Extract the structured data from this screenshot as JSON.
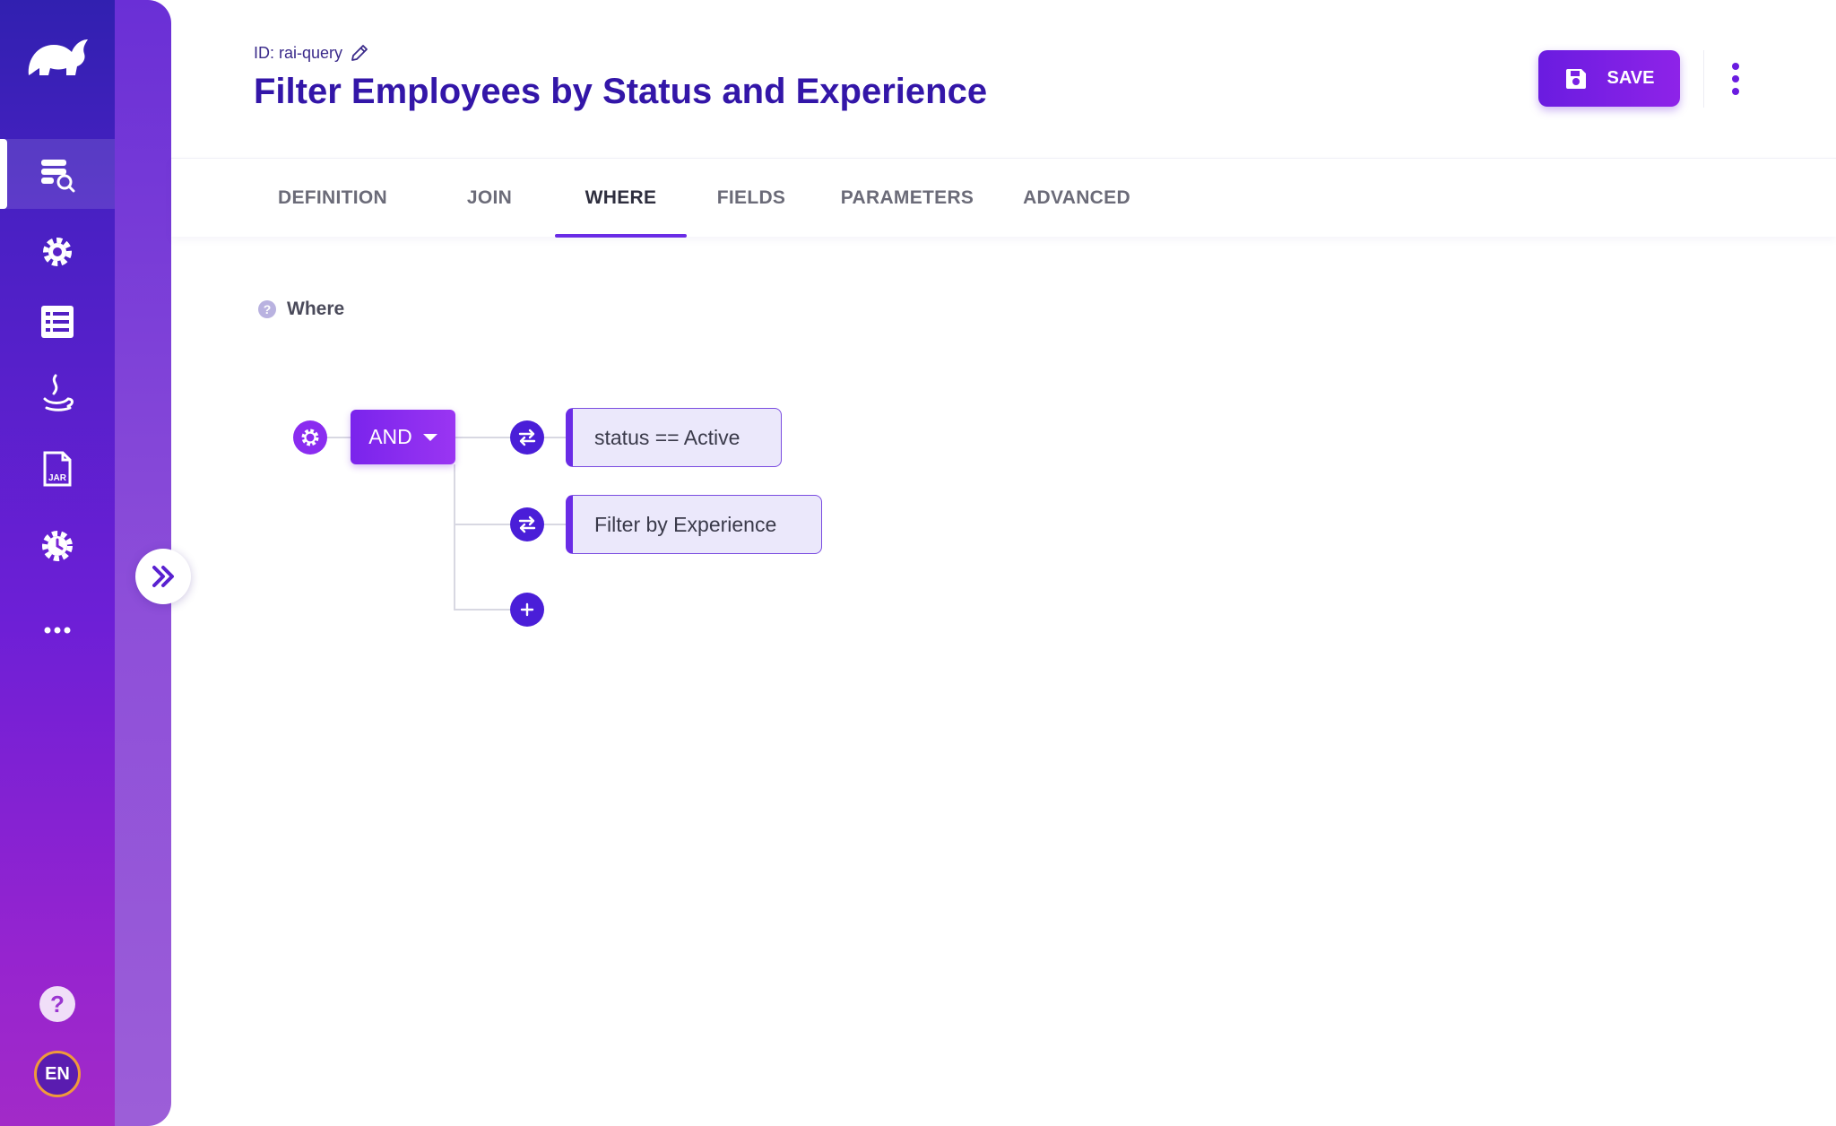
{
  "sidebar": {
    "nav": [
      {
        "icon": "query-search-icon",
        "active": true
      },
      {
        "icon": "settings-gear-icon"
      },
      {
        "icon": "list-icon"
      },
      {
        "icon": "java-icon"
      },
      {
        "icon": "jar-file-icon"
      },
      {
        "icon": "gear-clock-icon"
      },
      {
        "icon": "more-dots-icon"
      }
    ],
    "language": "EN"
  },
  "header": {
    "id_label": "ID: rai-query",
    "title": "Filter Employees by Status and Experience",
    "save_label": "SAVE"
  },
  "tabs": [
    {
      "label": "DEFINITION"
    },
    {
      "label": "JOIN"
    },
    {
      "label": "WHERE",
      "active": true
    },
    {
      "label": "FIELDS"
    },
    {
      "label": "PARAMETERS"
    },
    {
      "label": "ADVANCED"
    }
  ],
  "where": {
    "label": "Where",
    "operator": "AND",
    "rules": [
      {
        "text": "status == Active"
      },
      {
        "text": "Filter by Experience"
      }
    ]
  },
  "colors": {
    "accent": "#6a2ce6",
    "title": "#3316a8",
    "rule_bg": "#ebe8fb"
  }
}
